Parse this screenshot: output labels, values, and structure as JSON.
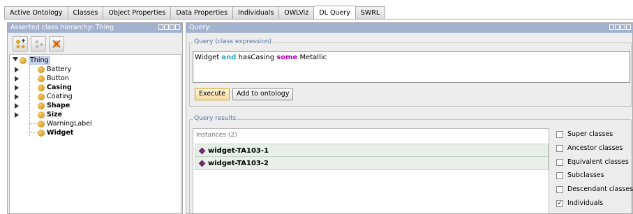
{
  "tabs": [
    {
      "label": "Active Ontology"
    },
    {
      "label": "Classes"
    },
    {
      "label": "Object Properties"
    },
    {
      "label": "Data Properties"
    },
    {
      "label": "Individuals"
    },
    {
      "label": "OWLViz"
    },
    {
      "label": "DL Query"
    },
    {
      "label": "SWRL"
    }
  ],
  "active_tab": "DL Query",
  "hierarchy": {
    "title": "Asserted class hierarchy: Thing",
    "root": "Thing",
    "classes": [
      {
        "label": "Battery",
        "expandable": true,
        "bold": false
      },
      {
        "label": "Button",
        "expandable": true,
        "bold": false
      },
      {
        "label": "Casing",
        "expandable": true,
        "bold": true
      },
      {
        "label": "Coating",
        "expandable": true,
        "bold": false
      },
      {
        "label": "Shape",
        "expandable": true,
        "bold": true
      },
      {
        "label": "Size",
        "expandable": true,
        "bold": true
      },
      {
        "label": "WarningLabel",
        "expandable": false,
        "bold": false
      },
      {
        "label": "Widget",
        "expandable": false,
        "bold": true
      }
    ]
  },
  "query": {
    "title": "Query:",
    "group_label": "Query (class expression)",
    "expr_part1": "Widget ",
    "expr_and": "and",
    "expr_part2": " hasCasing ",
    "expr_some": "some",
    "expr_part3": " Metallic",
    "execute_label": "Execute",
    "add_label": "Add to ontology"
  },
  "results": {
    "group_label": "Query results",
    "header": "Instances (2)",
    "items": [
      "widget-TA103-1",
      "widget-TA103-2"
    ]
  },
  "options": [
    {
      "label": "Super classes",
      "checked": false
    },
    {
      "label": "Ancestor classes",
      "checked": false
    },
    {
      "label": "Equivalent classes",
      "checked": false
    },
    {
      "label": "Subclasses",
      "checked": false
    },
    {
      "label": "Descendant classes",
      "checked": false
    },
    {
      "label": "Individuals",
      "checked": true
    }
  ]
}
